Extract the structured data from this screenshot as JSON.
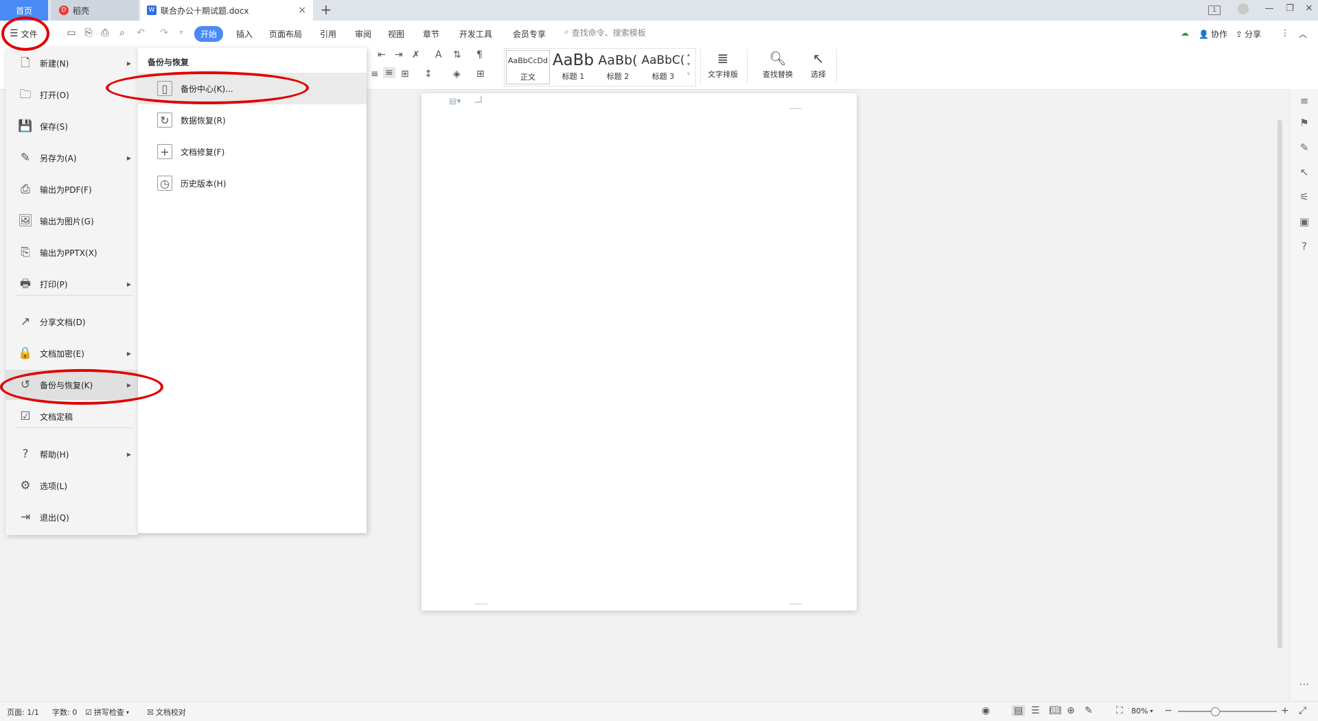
{
  "tabs": {
    "home": "首页",
    "daoke": "稻壳",
    "doc": "联合办公十期试题.docx",
    "close": "×",
    "add": "+"
  },
  "window_controls": [
    "1",
    "—",
    "❐",
    "✕"
  ],
  "toolbar": {
    "file_label": "文件",
    "menu_tabs": [
      "开始",
      "插入",
      "页面布局",
      "引用",
      "审阅",
      "视图",
      "章节",
      "开发工具",
      "会员专享"
    ],
    "search_placeholder": "查找命令、搜索模板",
    "collab_label": "协作",
    "share_label": "分享"
  },
  "ribbon": {
    "styles": [
      {
        "sample": "AaBbCcDd",
        "name": "正文"
      },
      {
        "sample": "AaBb",
        "name": "标题 1"
      },
      {
        "sample": "AaBb(",
        "name": "标题 2"
      },
      {
        "sample": "AaBbC(",
        "name": "标题 3"
      }
    ],
    "text_layout": "文字排版",
    "find_replace": "查找替换",
    "select": "选择"
  },
  "file_menu": {
    "items": [
      {
        "label": "新建(N)",
        "icon": "new-doc-icon",
        "glyph": "🗋",
        "arrow": true
      },
      {
        "label": "打开(O)",
        "icon": "folder-icon",
        "glyph": "🗀",
        "arrow": false
      },
      {
        "label": "保存(S)",
        "icon": "save-icon",
        "glyph": "💾",
        "arrow": false
      },
      {
        "label": "另存为(A)",
        "icon": "save-as-icon",
        "glyph": "✎",
        "arrow": true
      },
      {
        "label": "输出为PDF(F)",
        "icon": "pdf-icon",
        "glyph": "⎙",
        "arrow": false
      },
      {
        "label": "输出为图片(G)",
        "icon": "image-icon",
        "glyph": "🖼",
        "arrow": false
      },
      {
        "label": "输出为PPTX(X)",
        "icon": "pptx-icon",
        "glyph": "⎘",
        "arrow": false
      },
      {
        "label": "打印(P)",
        "icon": "print-icon",
        "glyph": "🖶",
        "arrow": true
      },
      {
        "label": "分享文档(D)",
        "icon": "share-icon",
        "glyph": "↗",
        "arrow": false
      },
      {
        "label": "文档加密(E)",
        "icon": "encrypt-icon",
        "glyph": "🔒",
        "arrow": true
      },
      {
        "label": "备份与恢复(K)",
        "icon": "backup-icon",
        "glyph": "↺",
        "arrow": true
      },
      {
        "label": "文档定稿",
        "icon": "finalize-icon",
        "glyph": "☑",
        "arrow": false
      },
      {
        "label": "帮助(H)",
        "icon": "help-icon",
        "glyph": "?",
        "arrow": true
      },
      {
        "label": "选项(L)",
        "icon": "gear-icon",
        "glyph": "⚙",
        "arrow": false
      },
      {
        "label": "退出(Q)",
        "icon": "exit-icon",
        "glyph": "⇥",
        "arrow": false
      }
    ]
  },
  "submenu": {
    "title": "备份与恢复",
    "items": [
      {
        "label": "备份中心(K)...",
        "icon": "backup-center-icon",
        "glyph": "▯"
      },
      {
        "label": "数据恢复(R)",
        "icon": "data-recovery-icon",
        "glyph": "↻"
      },
      {
        "label": "文档修复(F)",
        "icon": "doc-repair-icon",
        "glyph": "+"
      },
      {
        "label": "历史版本(H)",
        "icon": "history-icon",
        "glyph": "◷"
      }
    ]
  },
  "statusbar": {
    "page": "页面: 1/1",
    "words": "字数: 0",
    "spellcheck": "拼写检查",
    "proofread": "文档校对",
    "zoom": "80%"
  },
  "colors": {
    "accent": "#4a8af4",
    "annotation": "#e00000"
  }
}
